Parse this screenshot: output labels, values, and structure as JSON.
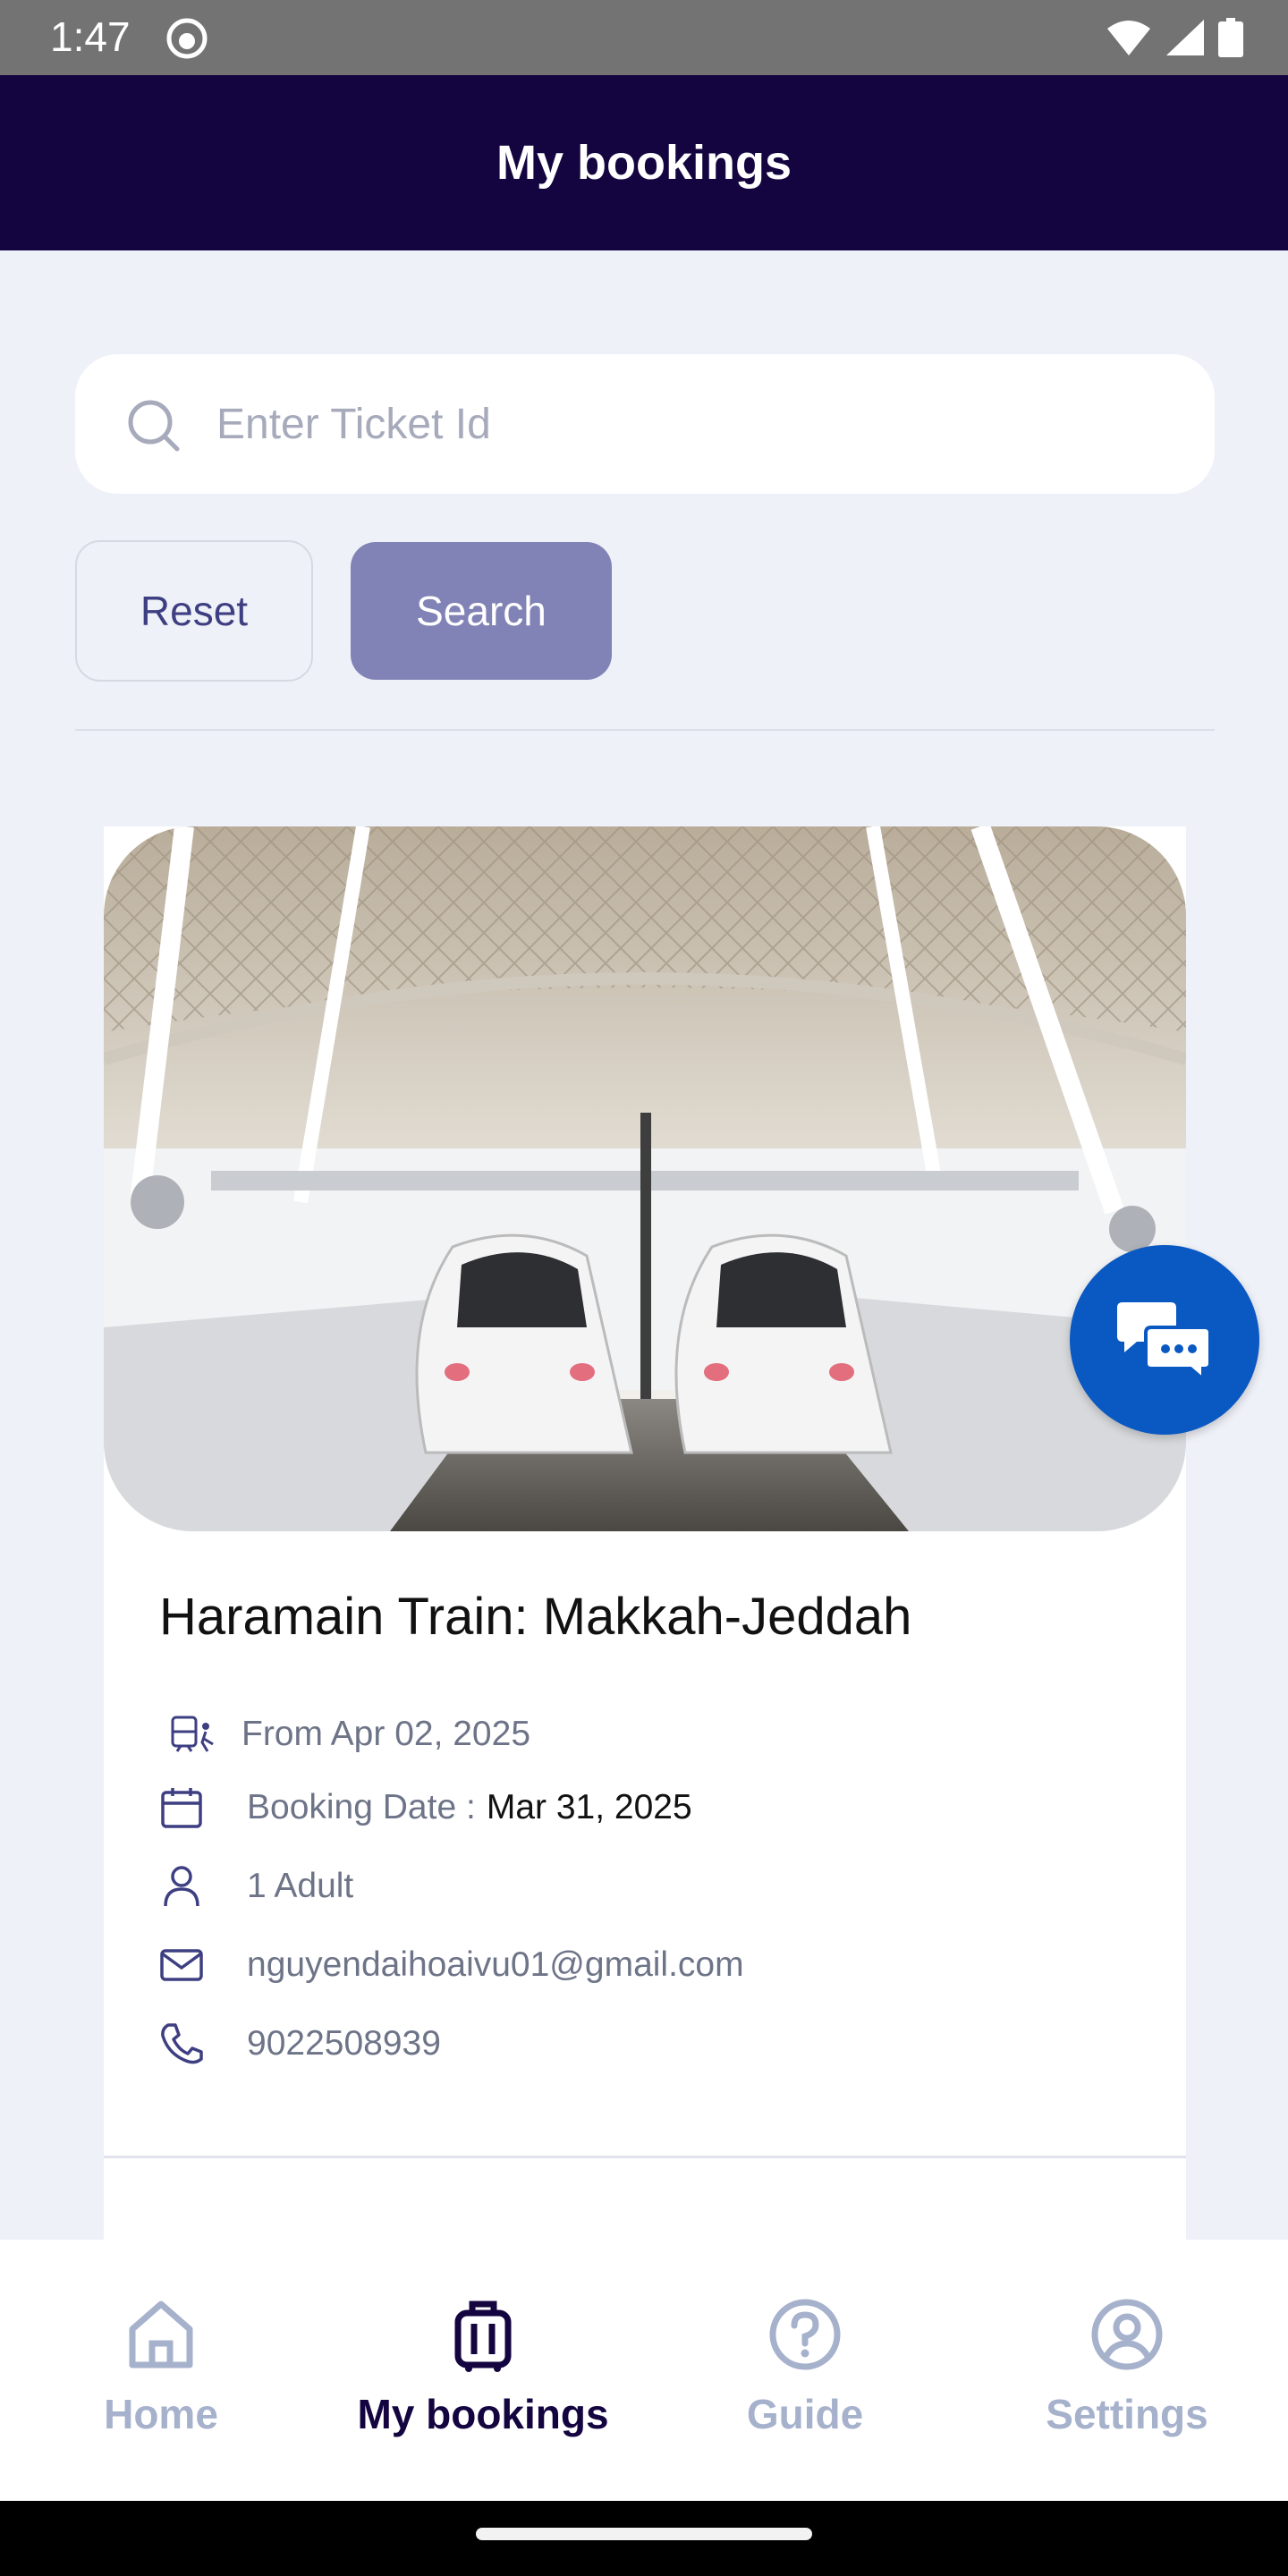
{
  "status_bar": {
    "time": "1:47"
  },
  "app_bar": {
    "title": "My bookings"
  },
  "search": {
    "placeholder": "Enter Ticket Id",
    "value": ""
  },
  "buttons": {
    "reset": "Reset",
    "search": "Search"
  },
  "booking": {
    "title": "Haramain Train: Makkah-Jeddah",
    "from_date": "From Apr 02, 2025",
    "booking_date_label": "Booking Date :",
    "booking_date_value": "Mar 31, 2025",
    "passengers": "1 Adult",
    "email": "nguyendaihoaivu01@gmail.com",
    "phone": "9022508939"
  },
  "bottom_nav": {
    "items": [
      {
        "label": "Home",
        "icon": "home-icon",
        "active": false
      },
      {
        "label": "My bookings",
        "icon": "luggage-icon",
        "active": true
      },
      {
        "label": "Guide",
        "icon": "question-circle-icon",
        "active": false
      },
      {
        "label": "Settings",
        "icon": "user-circle-icon",
        "active": false
      }
    ]
  },
  "colors": {
    "app_bar": "#140541",
    "accent_button": "#8183b6",
    "chat_fab": "#0a59c2",
    "nav_inactive": "#a6b1cc"
  }
}
